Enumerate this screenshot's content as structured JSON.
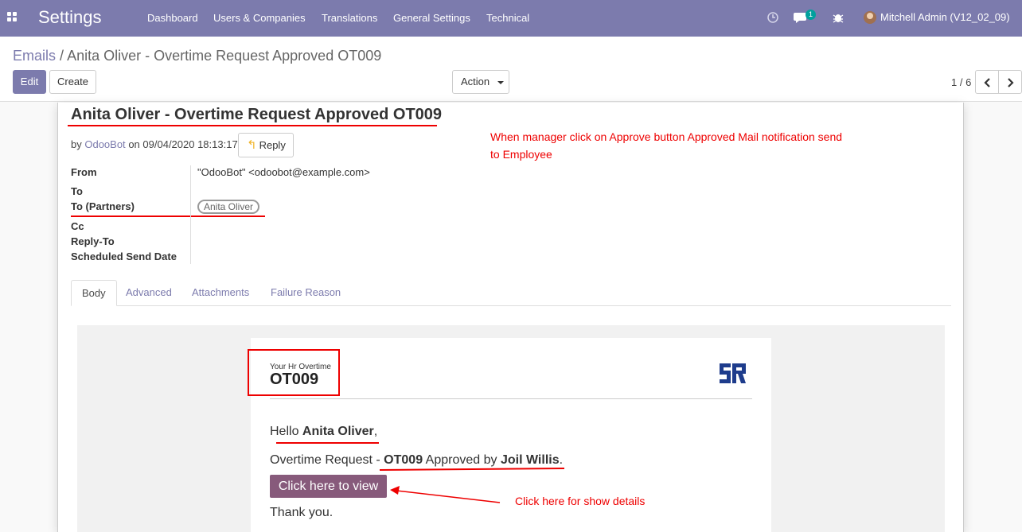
{
  "navbar": {
    "app_title": "Settings",
    "menu": [
      "Dashboard",
      "Users & Companies",
      "Translations",
      "General Settings",
      "Technical"
    ],
    "chat_count": "1",
    "user": "Mitchell Admin (V12_02_09)"
  },
  "control_panel": {
    "breadcrumb_parent": "Emails",
    "breadcrumb_sep": "/",
    "breadcrumb_current": "Anita Oliver - Overtime Request Approved OT009",
    "edit_label": "Edit",
    "create_label": "Create",
    "action_label": "Action",
    "pager": "1 / 6"
  },
  "record": {
    "title": "Anita Oliver - Overtime Request Approved OT009",
    "by_prefix": "by",
    "author": "OdooBot",
    "date_prefix": "on",
    "date": "09/04/2020 18:13:17",
    "reply_label": "Reply",
    "fields": {
      "from_label": "From",
      "from_value": "\"OdooBot\" <odoobot@example.com>",
      "to_label": "To",
      "to_partners_label": "To (Partners)",
      "to_partner_tag": "Anita Oliver",
      "cc_label": "Cc",
      "reply_to_label": "Reply-To",
      "scheduled_label": "Scheduled Send Date"
    },
    "tabs": [
      "Body",
      "Advanced",
      "Attachments",
      "Failure Reason"
    ]
  },
  "mail": {
    "header_small": "Your Hr Overtime",
    "header_big": "OT009",
    "greeting_prefix": "Hello",
    "greeting_name": "Anita Oliver",
    "greeting_suffix": ",",
    "line_prefix": "Overtime Request -",
    "line_ref": "OT009",
    "line_mid": "Approved by",
    "line_manager": "Joil Willis",
    "line_suffix": ".",
    "button_label": "Click here to view",
    "thanks": "Thank you."
  },
  "annotations": {
    "note_top_line1": "When manager click on Approve button Approved Mail notification send",
    "note_top_line2": "to  Employee",
    "note_bottom": "Click here for show details",
    "color": "#ee0000"
  },
  "colors": {
    "brand": "#7c7bad",
    "mail_button": "#875a7b"
  }
}
